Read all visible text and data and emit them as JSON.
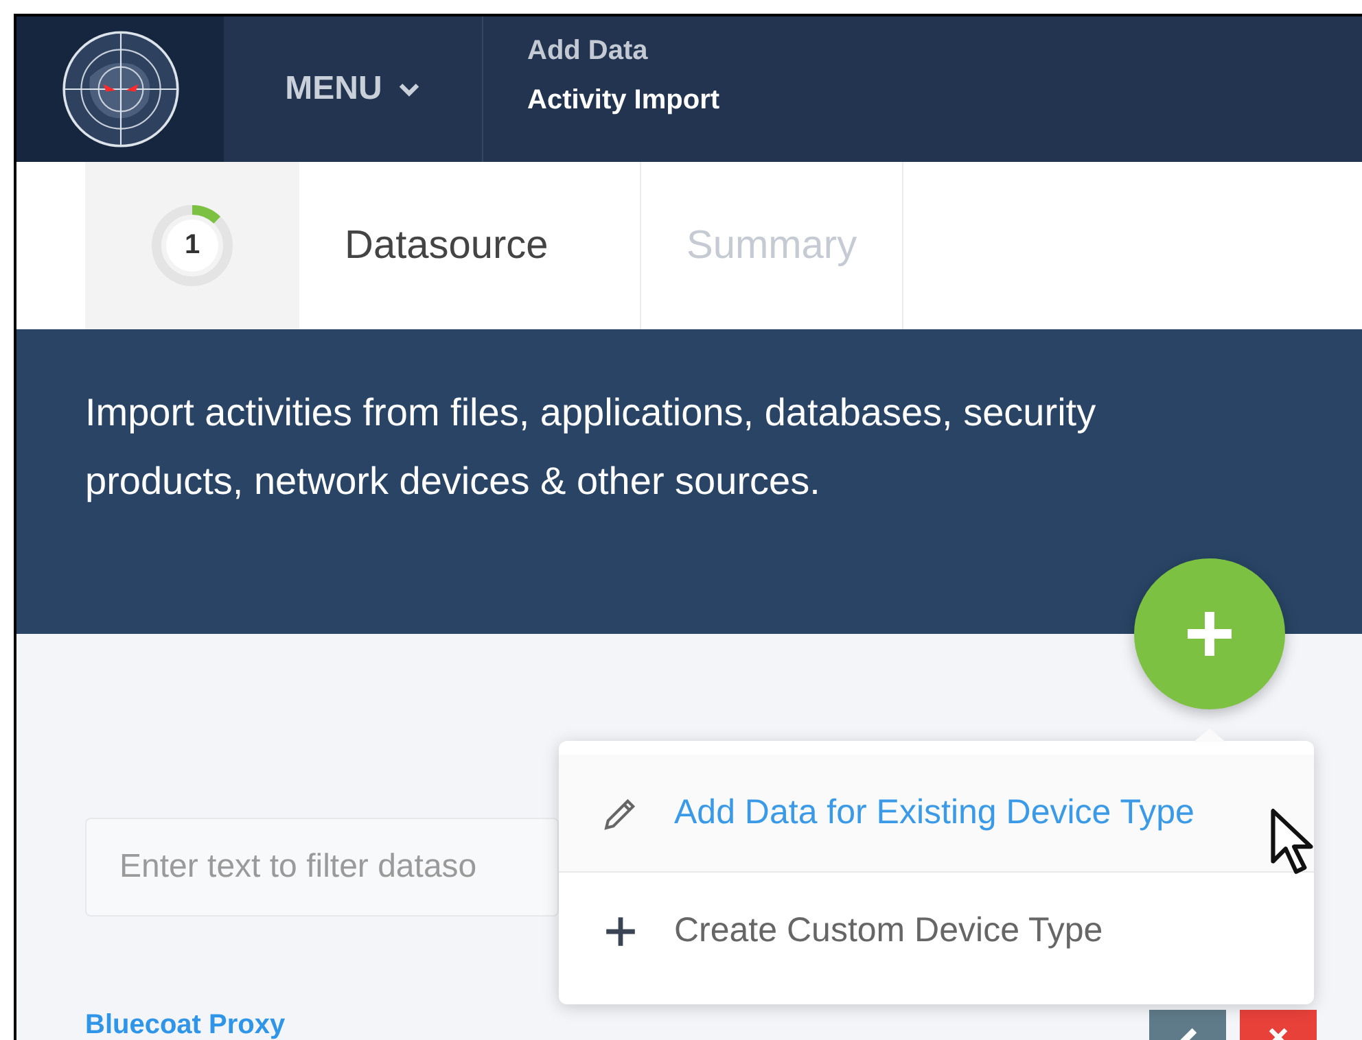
{
  "header": {
    "menu_label": "MENU",
    "breadcrumb": "Add Data",
    "title": "Activity Import"
  },
  "steps": [
    {
      "number": "1",
      "label": "Datasource",
      "selected": true
    },
    {
      "label": "Summary",
      "selected": false
    }
  ],
  "banner": {
    "text": "Import activities from files, applications, databases, security products, network devices & other sources."
  },
  "add_menu": {
    "items": [
      {
        "kind": "edit",
        "label": "Add Data for Existing Device Type",
        "selected": true
      },
      {
        "kind": "add",
        "label": "Create Custom Device Type",
        "selected": false
      }
    ]
  },
  "filter": {
    "placeholder": "Enter text to filter dataso"
  },
  "datasources": [
    {
      "name": "Bluecoat Proxy"
    }
  ]
}
